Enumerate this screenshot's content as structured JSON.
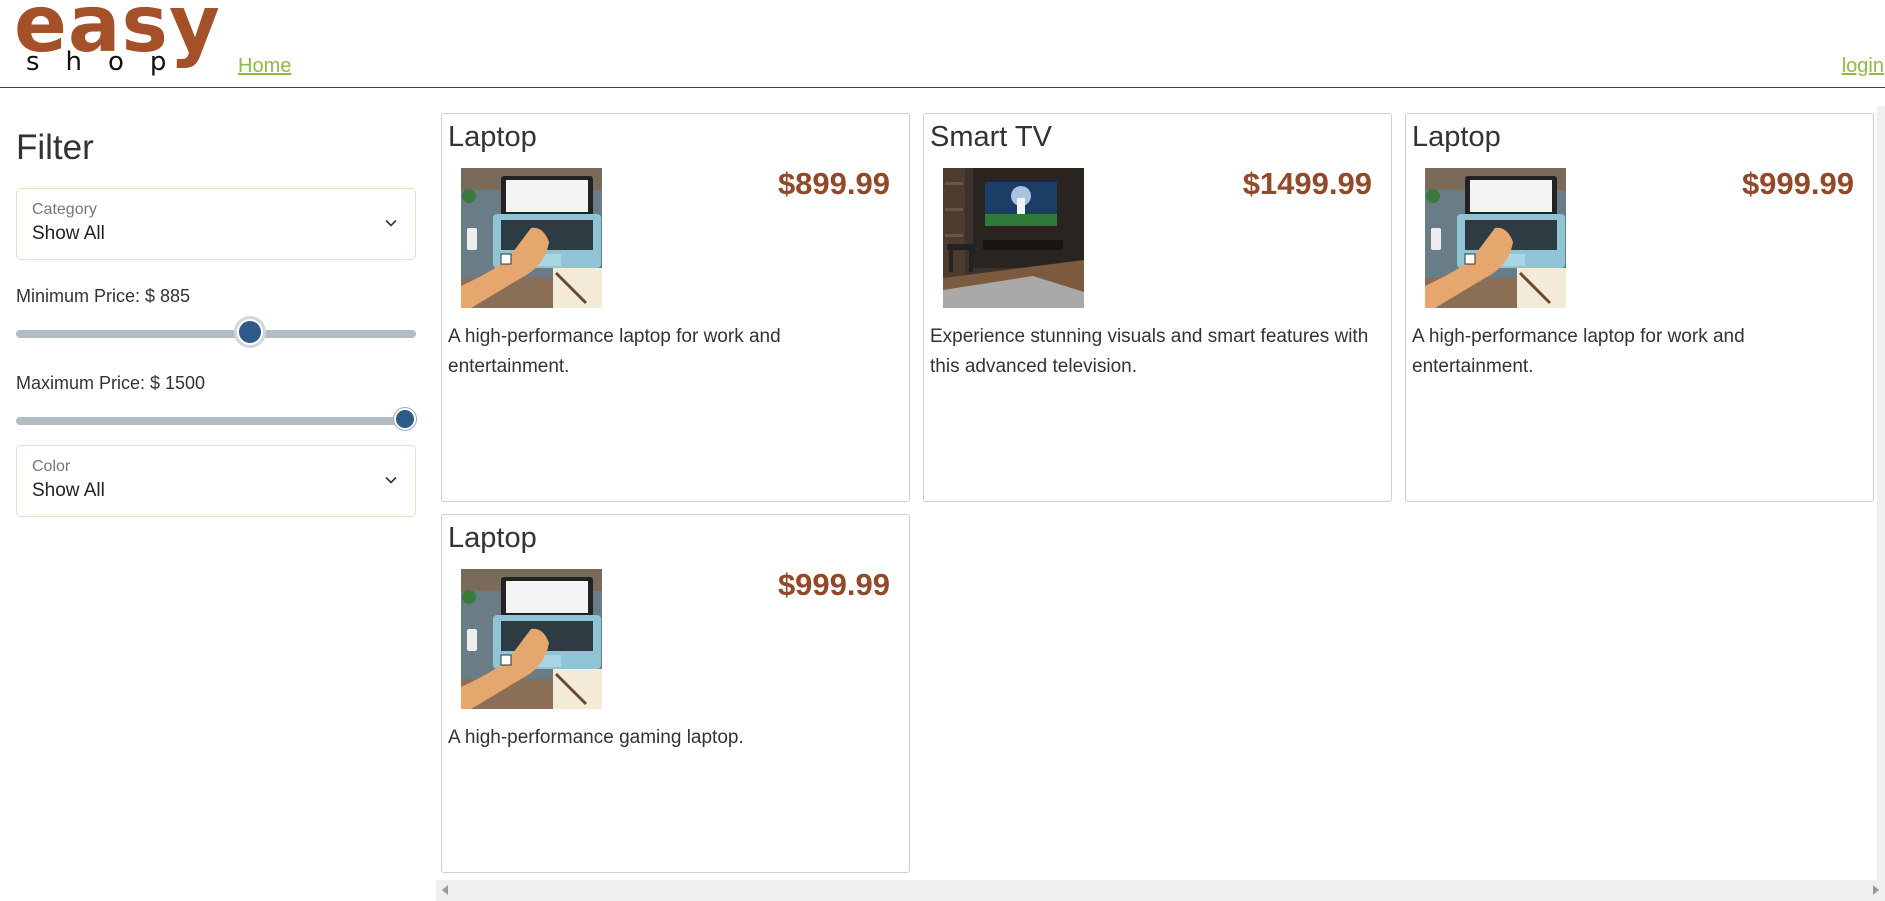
{
  "header": {
    "logo_top": "easy",
    "logo_bottom": "shop",
    "nav_home": "Home",
    "nav_login": "login"
  },
  "sidebar": {
    "title": "Filter",
    "category": {
      "label": "Category",
      "value": "Show All"
    },
    "min_price": {
      "label": "Minimum Price: $ 885",
      "value": 885,
      "range_min": 0,
      "range_max": 1500
    },
    "max_price": {
      "label": "Maximum Price: $ 1500",
      "value": 1500,
      "range_min": 0,
      "range_max": 1500
    },
    "color": {
      "label": "Color",
      "value": "Show All"
    }
  },
  "products": [
    {
      "name": "Laptop",
      "price": "$899.99",
      "image": "laptop-image",
      "description": "A high-performance laptop for work and entertainment."
    },
    {
      "name": "Smart TV",
      "price": "$1499.99",
      "image": "smart-tv-image",
      "description": "Experience stunning visuals and smart features with this advanced television."
    },
    {
      "name": "Laptop",
      "price": "$999.99",
      "image": "laptop-image",
      "description": "A high-performance laptop for work and entertainment."
    },
    {
      "name": "Laptop",
      "price": "$999.99",
      "image": "laptop-image",
      "description": "A high-performance gaming laptop."
    }
  ],
  "colors": {
    "brand": "#a4512a",
    "price": "#91492a",
    "link": "#8dbb47",
    "slider_thumb": "#2d5a87"
  }
}
